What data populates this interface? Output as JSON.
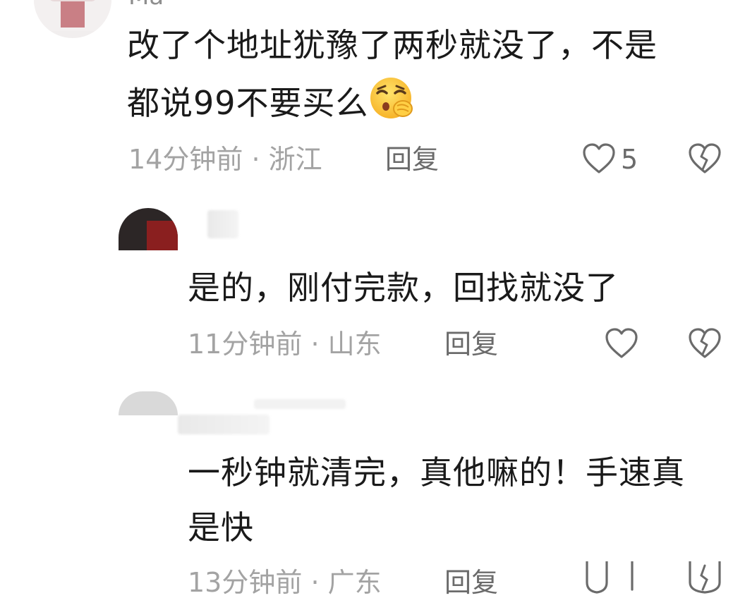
{
  "comments": [
    {
      "username": "Ma",
      "text_line1": "改了个地址犹豫了两秒就没了，不是",
      "text_line2": "都说99不要买么",
      "emoji": "sleepy-face-emoji",
      "time": "14分钟前",
      "location": "浙江",
      "reply_label": "回复",
      "like_count": "5"
    },
    {
      "text_line1": "是的，刚付完款，回找就没了",
      "time": "11分钟前",
      "location": "山东",
      "reply_label": "回复"
    },
    {
      "text_line1": "一秒钟就清完，真他嘛的！手速真",
      "text_line2": "是快",
      "time": "13分钟前",
      "location": "广东",
      "reply_label": "回复"
    }
  ],
  "meta_separator": " · ",
  "colors": {
    "text": "#1a1a1a",
    "meta": "#a3a3a3",
    "reply": "#6b6b6b",
    "icon": "#6b6b6b"
  }
}
